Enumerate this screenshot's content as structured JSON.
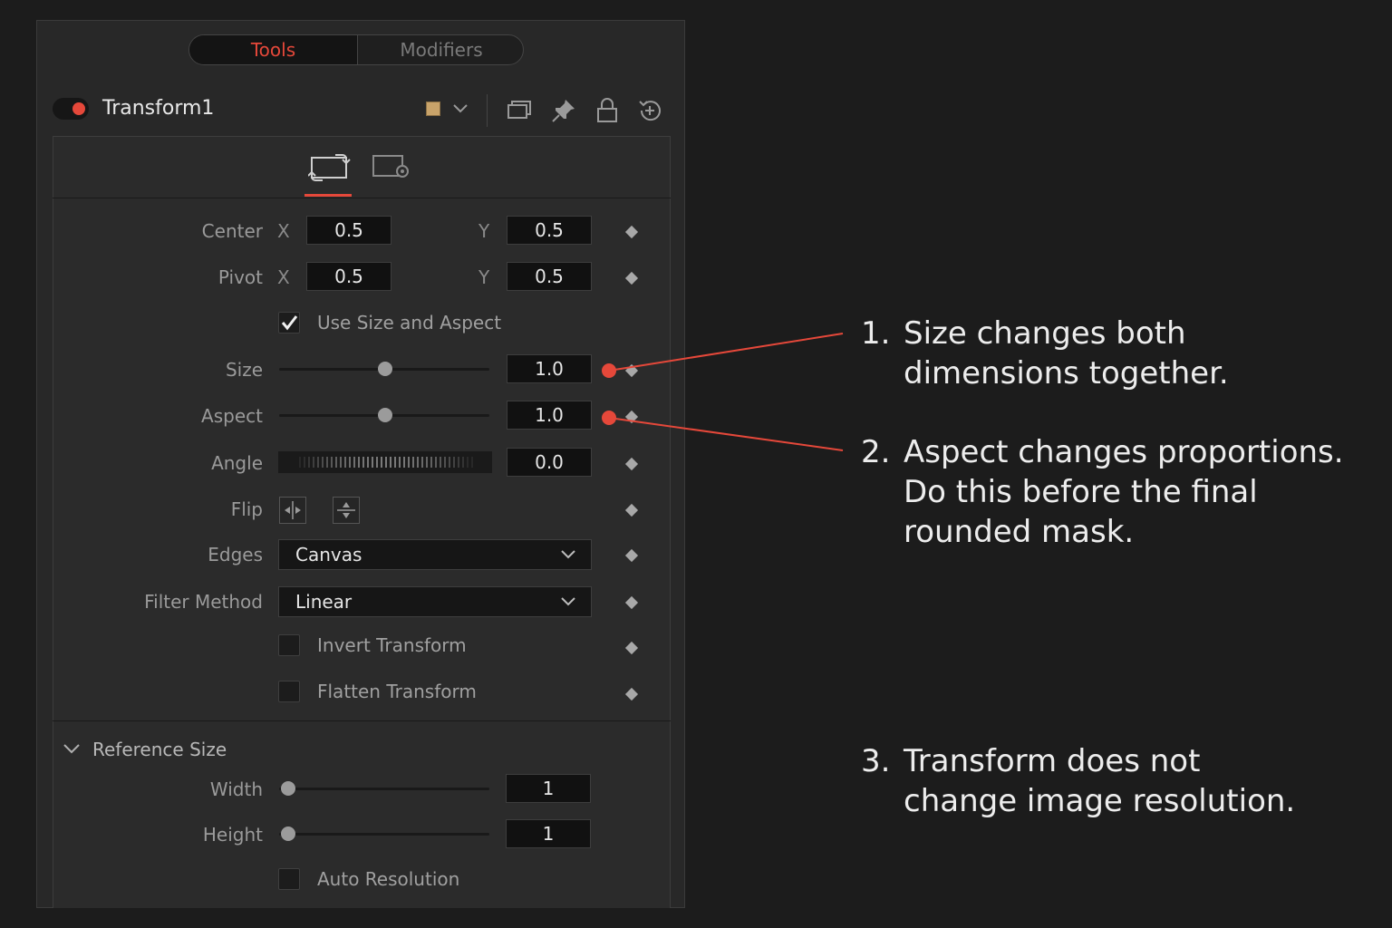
{
  "tabs": {
    "tools": "Tools",
    "modifiers": "Modifiers"
  },
  "node": {
    "name": "Transform1",
    "swatch_color": "#c8a36a",
    "enabled": true
  },
  "header_icons": [
    "swatch-dropdown-icon",
    "window-icon",
    "pin-icon",
    "lock-icon",
    "reset-icon"
  ],
  "panel_tabs": [
    "transform-tab-icon",
    "settings-tab-icon"
  ],
  "controls": {
    "center": {
      "label": "Center",
      "x_label": "X",
      "x": "0.5",
      "y_label": "Y",
      "y": "0.5"
    },
    "pivot": {
      "label": "Pivot",
      "x_label": "X",
      "x": "0.5",
      "y_label": "Y",
      "y": "0.5"
    },
    "use_size_aspect": {
      "label": "Use Size and Aspect",
      "checked": true
    },
    "size": {
      "label": "Size",
      "value": "1.0",
      "slider_level": 0.5
    },
    "aspect": {
      "label": "Aspect",
      "value": "1.0",
      "slider_level": 0.5
    },
    "angle": {
      "label": "Angle",
      "value": "0.0"
    },
    "flip": {
      "label": "Flip"
    },
    "edges": {
      "label": "Edges",
      "value": "Canvas"
    },
    "filter_method": {
      "label": "Filter Method",
      "value": "Linear"
    },
    "invert_transform": {
      "label": "Invert Transform",
      "checked": false
    },
    "flatten_transform": {
      "label": "Flatten Transform",
      "checked": false
    }
  },
  "reference_size": {
    "title": "Reference Size",
    "width": {
      "label": "Width",
      "value": "1",
      "slider_level": 0
    },
    "height": {
      "label": "Height",
      "value": "1",
      "slider_level": 0
    },
    "auto_resolution": {
      "label": "Auto Resolution",
      "checked": false
    }
  },
  "annotations": [
    {
      "num": "1.",
      "lines": [
        "Size changes both",
        "dimensions together."
      ]
    },
    {
      "num": "2.",
      "lines": [
        "Aspect changes proportions.",
        "Do this before the final",
        "rounded mask."
      ]
    },
    {
      "num": "3.",
      "lines": [
        "Transform does not",
        "change image resolution."
      ]
    }
  ],
  "colors": {
    "accent": "#e5483a",
    "background": "#1c1c1c",
    "panel": "#282828"
  }
}
